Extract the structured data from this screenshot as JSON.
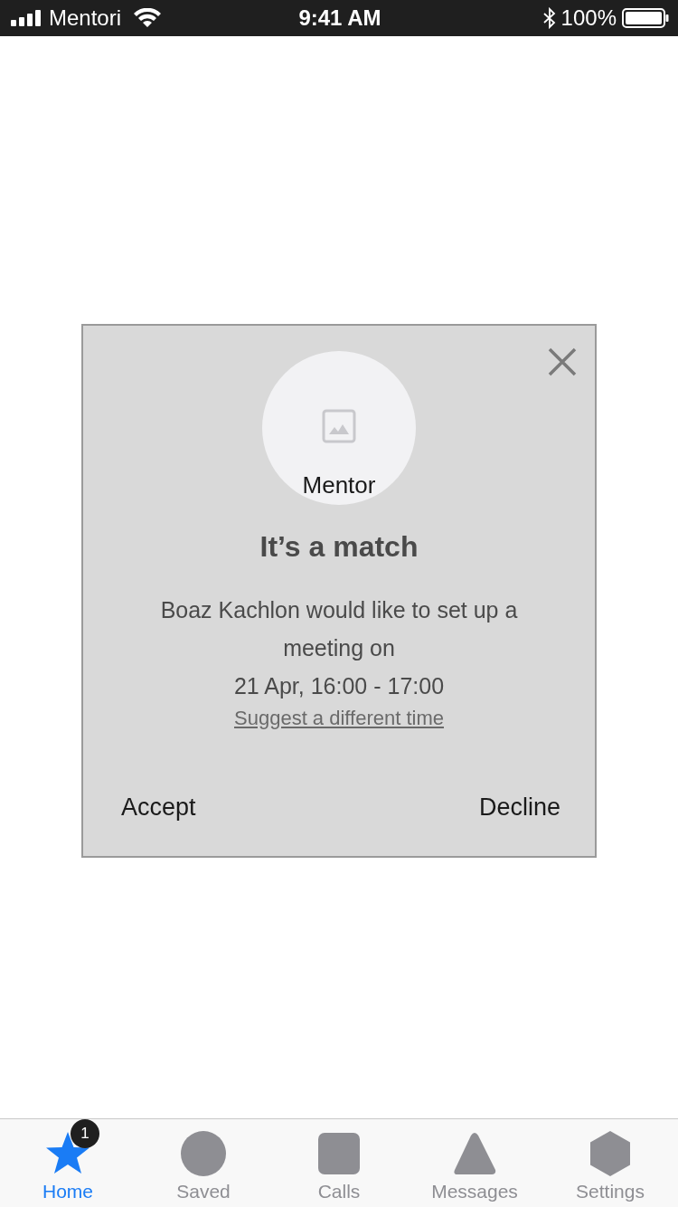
{
  "status_bar": {
    "carrier": "Mentori",
    "time": "9:41 AM",
    "battery": "100%"
  },
  "dialog": {
    "avatar_label": "Mentor",
    "title": "It’s a match",
    "message": "Boaz Kachlon would like to set up a meeting on",
    "when": "21 Apr, 16:00 - 17:00",
    "link": "Suggest a different time",
    "actions": [
      "Accept",
      "Decline"
    ]
  },
  "tabs": [
    {
      "label": "Home",
      "kind": "star",
      "selected": true,
      "badge": "1"
    },
    {
      "label": "Saved",
      "kind": "circle",
      "selected": false
    },
    {
      "label": "Calls",
      "kind": "square",
      "selected": false
    },
    {
      "label": "Messages",
      "kind": "triangle",
      "selected": false
    },
    {
      "label": "Settings",
      "kind": "hexagon",
      "selected": false
    }
  ]
}
